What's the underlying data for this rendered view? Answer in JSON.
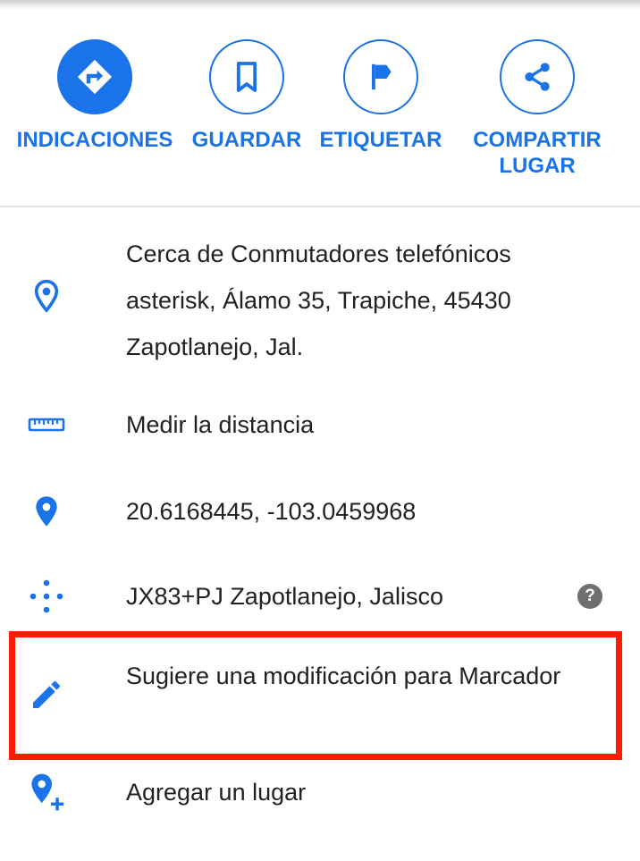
{
  "actions": {
    "directions": {
      "label": "INDICACIONES",
      "icon": "directions-icon"
    },
    "save": {
      "label": "GUARDAR",
      "icon": "bookmark-icon"
    },
    "label": {
      "label": "ETIQUETAR",
      "icon": "flag-icon"
    },
    "share": {
      "label": "COMPARTIR\nLUGAR",
      "icon": "share-icon"
    }
  },
  "details": {
    "address": {
      "text": "Cerca de Conmutadores telefónicos asterisk, Álamo 35, Trapiche, 45430 Zapotlanejo, Jal.",
      "icon": "location-outline-icon"
    },
    "measure": {
      "text": "Medir la distancia",
      "icon": "ruler-icon"
    },
    "coordinates": {
      "text": "20.6168445, -103.0459968",
      "icon": "location-pin-icon"
    },
    "plus_code": {
      "text": "JX83+PJ Zapotlanejo, Jalisco",
      "icon": "plus-code-icon",
      "help_glyph": "?"
    },
    "suggest_edit": {
      "text": "Sugiere una modificación para Marcador",
      "icon": "pencil-icon"
    },
    "add_place": {
      "text": "Agregar un lugar",
      "icon": "add-location-icon"
    }
  },
  "colors": {
    "accent": "#1a73e8",
    "text": "#212121",
    "highlight": "#ff1a00",
    "help_badge": "#6f6f6f"
  }
}
